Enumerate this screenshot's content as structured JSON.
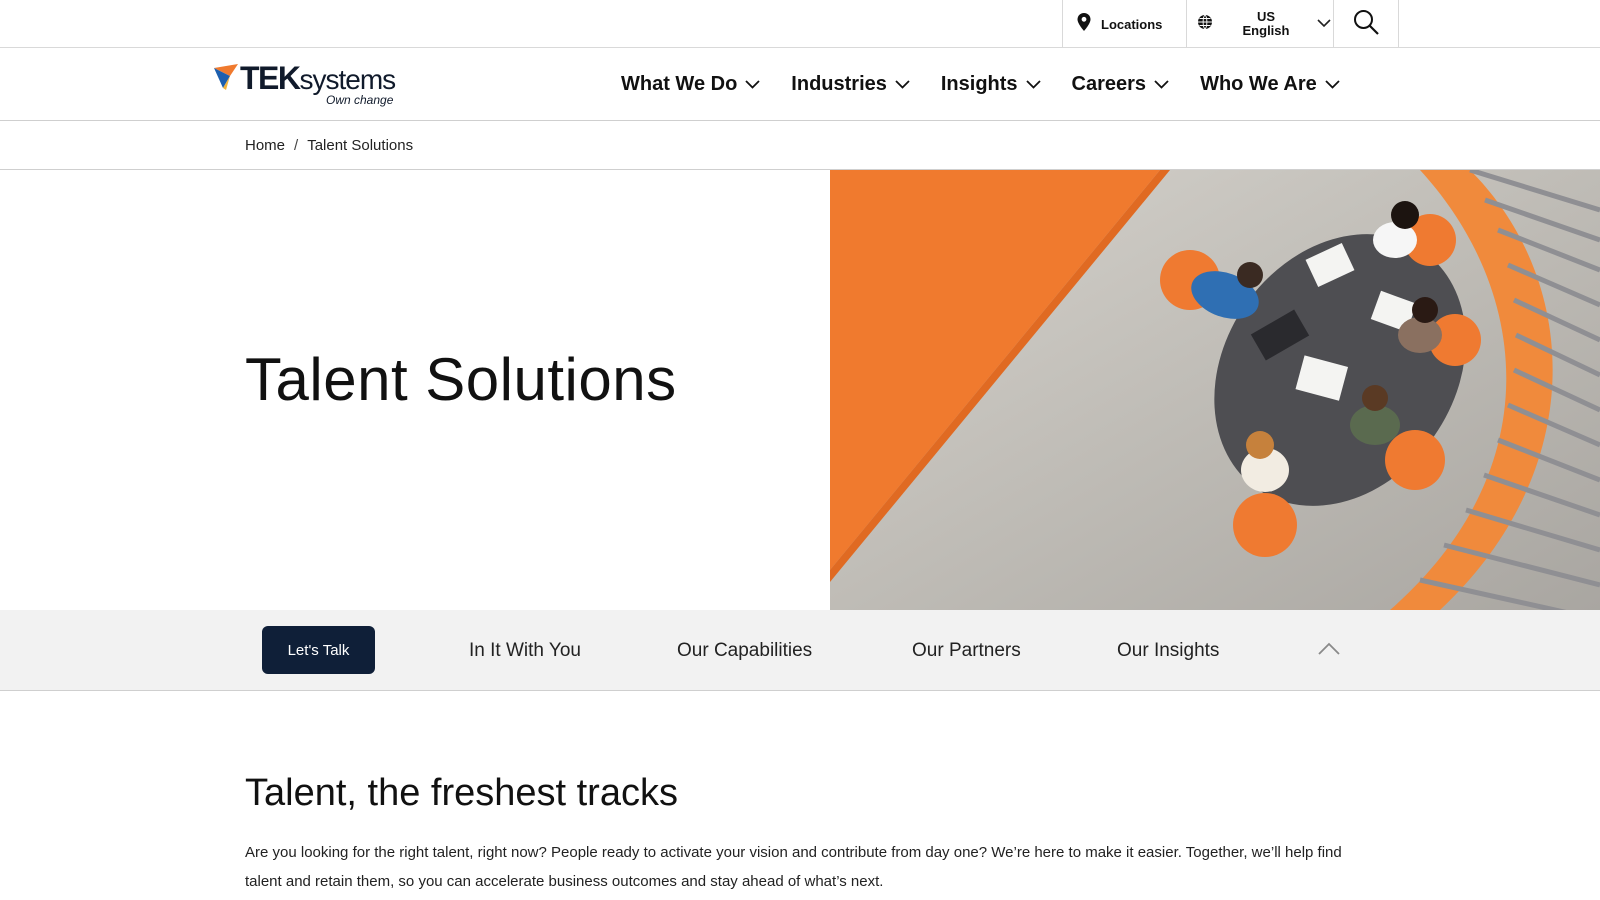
{
  "utility": {
    "locations_label": "Locations",
    "lang_country": "US",
    "lang_language": "English"
  },
  "logo": {
    "brand_bold": "TEK",
    "brand_light": "systems",
    "tagline": "Own change"
  },
  "nav": {
    "items": [
      {
        "label": "What We Do"
      },
      {
        "label": "Industries"
      },
      {
        "label": "Insights"
      },
      {
        "label": "Careers"
      },
      {
        "label": "Who We Are"
      }
    ]
  },
  "breadcrumb": {
    "home": "Home",
    "separator": "/",
    "current": "Talent Solutions"
  },
  "hero": {
    "title": "Talent Solutions"
  },
  "subnav": {
    "cta_label": "Let's Talk",
    "links": [
      {
        "label": "In It With You"
      },
      {
        "label": "Our Capabilities"
      },
      {
        "label": "Our Partners"
      },
      {
        "label": "Our Insights"
      }
    ]
  },
  "content": {
    "heading": "Talent, the freshest tracks",
    "body": "Are you looking for the right talent, right now? People ready to activate your vision and contribute from day one? We’re here to make it easier. Together, we’ll help find talent and retain them, so you can accelerate business outcomes and stay ahead of what’s next."
  },
  "colors": {
    "navy": "#0f1f38",
    "accent_orange": "#f07a2e",
    "subnav_bg": "#f2f2f2"
  }
}
